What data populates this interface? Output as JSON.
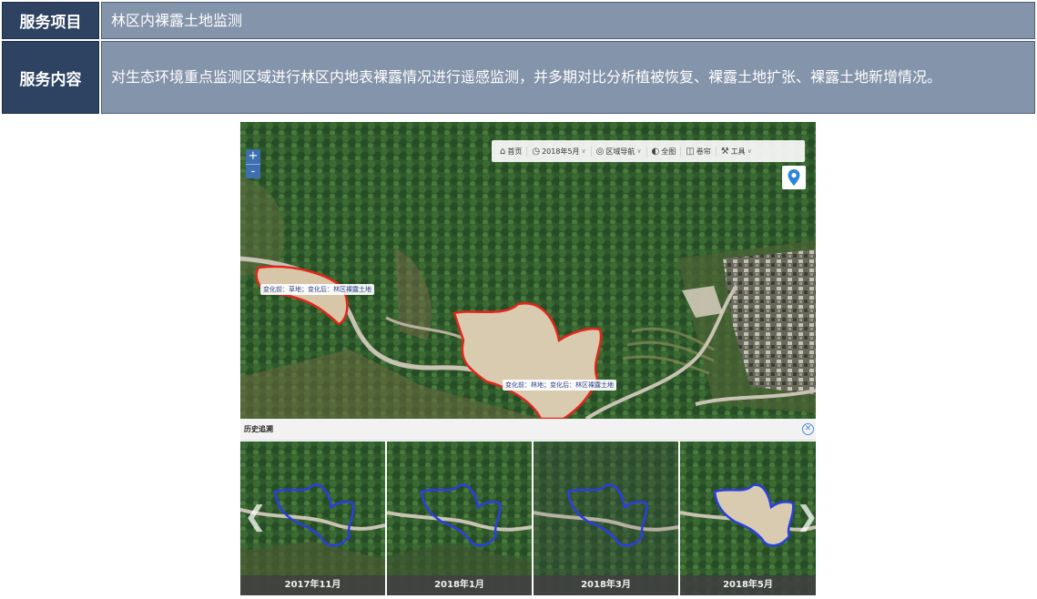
{
  "info": {
    "rows": [
      {
        "label": "服务项目",
        "value": "林区内裸露土地监测"
      },
      {
        "label": "服务内容",
        "value": "对生态环境重点监测区域进行林区内地表裸露情况进行遥感监测，并多期对比分析植被恢复、裸露土地扩张、裸露土地新增情况。"
      }
    ]
  },
  "map": {
    "zoom": {
      "in_label": "+",
      "out_label": "-"
    },
    "toolbar": {
      "home": {
        "label": "首页",
        "icon": "home-icon"
      },
      "date": {
        "label": "2018年5月",
        "icon": "clock-icon"
      },
      "region": {
        "label": "区域导航",
        "icon": "compass-icon"
      },
      "full": {
        "label": "全图",
        "icon": "globe-icon"
      },
      "split": {
        "label": "卷帘",
        "icon": "split-icon"
      },
      "tools": {
        "label": "工具",
        "icon": "toolbox-icon"
      }
    },
    "locate_icon": "location-pin-icon",
    "labels": [
      {
        "text": "变化前：草地；变化后：林区裸露土地"
      },
      {
        "text": "变化前：林地；变化后：林区裸露土地"
      }
    ],
    "colors": {
      "boundary": "#e2261c",
      "history_boundary": "#2a3fe0",
      "toolbar_accent": "#3d6fb0"
    }
  },
  "history": {
    "title": "历史追溯",
    "close_icon": "close-circle-icon",
    "prev_icon": "chevron-left-icon",
    "next_icon": "chevron-right-icon",
    "thumbs": [
      {
        "label": "2017年11月"
      },
      {
        "label": "2018年1月"
      },
      {
        "label": "2018年3月"
      },
      {
        "label": "2018年5月"
      }
    ]
  }
}
